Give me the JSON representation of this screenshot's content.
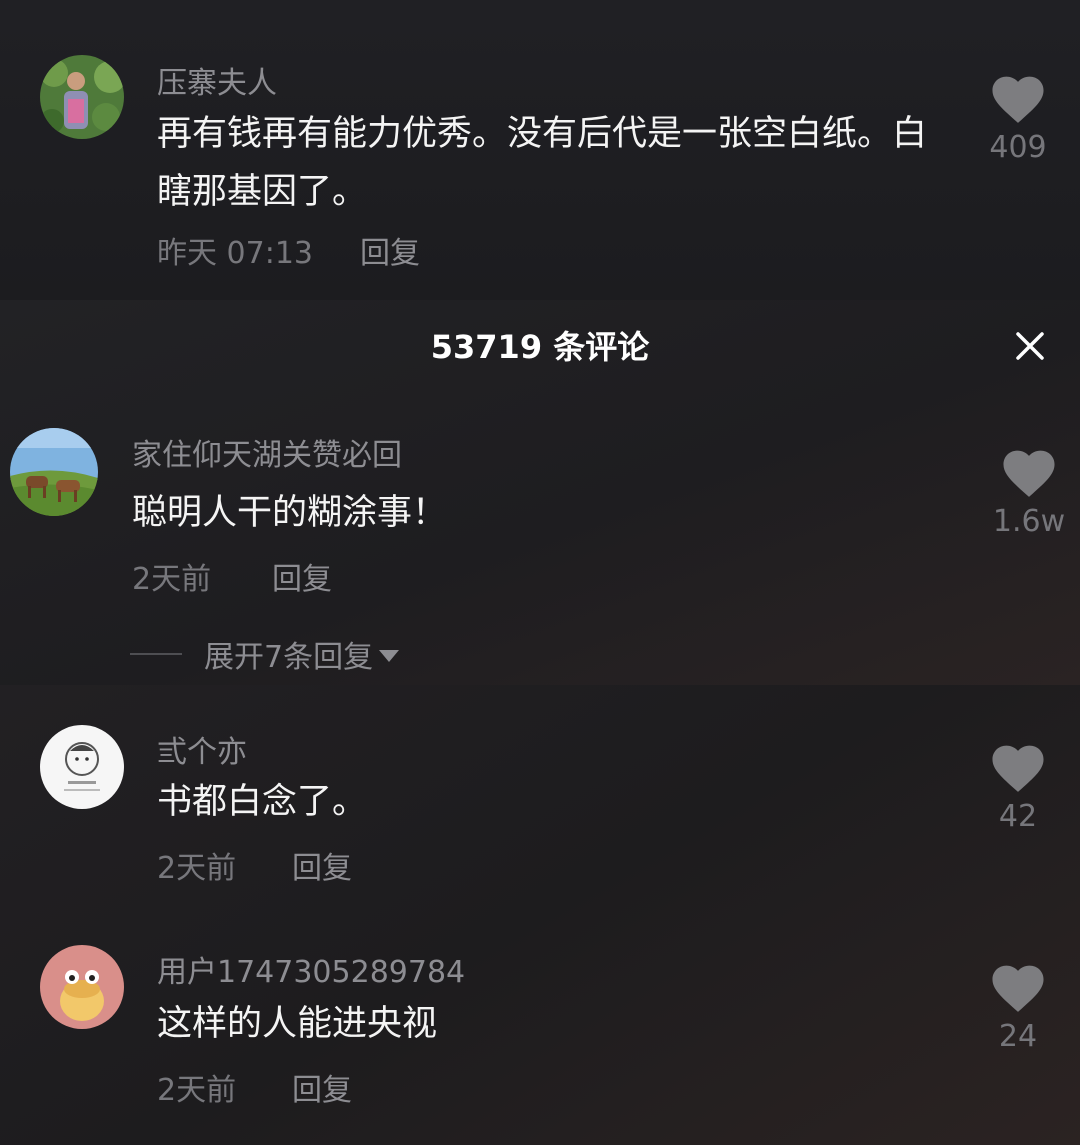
{
  "panel": {
    "title": "53719 条评论"
  },
  "comments": [
    {
      "username": "压寨夫人",
      "text": "再有钱再有能力优秀。没有后代是一张空白纸。白瞎那基因了。",
      "time": "昨天 07:13",
      "reply_label": "回复",
      "likes": "409",
      "avatar_icon": "person-in-garden-avatar"
    },
    {
      "username": "家住仰天湖关赞必回",
      "text": "聪明人干的糊涂事！",
      "time": "2天前",
      "reply_label": "回复",
      "likes": "1.6w",
      "avatar_icon": "horses-grassland-avatar",
      "expand_label": "展开7条回复"
    },
    {
      "username": "弎个亦",
      "text": "书都白念了。",
      "time": "2天前",
      "reply_label": "回复",
      "likes": "42",
      "avatar_icon": "cartoon-sketch-avatar"
    },
    {
      "username": "用户1747305289784",
      "text": "这样的人能进央视",
      "time": "2天前",
      "reply_label": "回复",
      "likes": "24",
      "avatar_icon": "cartoon-bun-avatar"
    }
  ],
  "colors": {
    "background": "#1a1a1c",
    "text": "#f4f4f4",
    "muted": "#8d8d92",
    "heart": "#7d7d80"
  }
}
